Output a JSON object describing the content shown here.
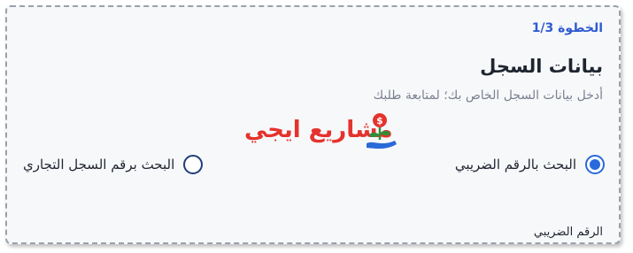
{
  "form": {
    "step": "الخطوة 1/3",
    "title": "بيانات السجل",
    "subtitle": "أدخل بيانات السجل الخاص بك؛ لمتابعة طلبك",
    "logo": {
      "text": "مشاريع ايجي",
      "icon": "plant-coin-hand-icon"
    },
    "search_options": [
      {
        "label": "البحث بالرقم الضريبي",
        "checked": true
      },
      {
        "label": "البحث برقم السجل التجاري",
        "checked": false
      }
    ],
    "tax_number_label": "الرقم الضريبي"
  },
  "colors": {
    "accent": "#2a69d9",
    "step_text": "#2e5bd1",
    "logo_red": "#e5322d",
    "logo_green": "#2f8f3a"
  }
}
